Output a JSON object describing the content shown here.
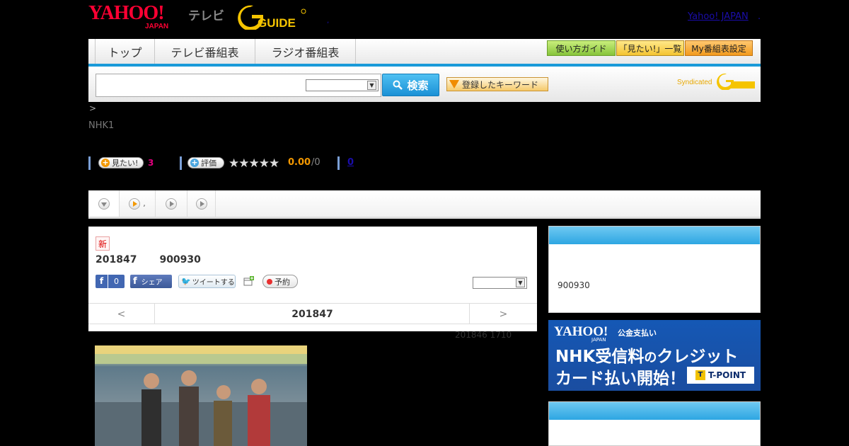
{
  "header": {
    "logo_yahoo": "YAHOO!",
    "logo_japan": "JAPAN",
    "logo_tv": "テレビ",
    "logo_gguide": "GUIDE",
    "yahoo_japan_link": "Yahoo! JAPAN",
    "dot_link": ".",
    "dot_mid": ","
  },
  "nav": {
    "tabs": [
      "トップ",
      "テレビ番組表",
      "ラジオ番組表"
    ],
    "buttons": [
      "使い方ガイド",
      "「見たい!」一覧",
      "My番組表設定"
    ]
  },
  "search": {
    "input_value": "",
    "select_value": "",
    "search_label": "検索",
    "keyword_label": "登録したキーワード",
    "syndicated": "Syndicated"
  },
  "breadcrumb": ">",
  "channel": "NHK1",
  "ratings": {
    "want_label": "見たい!",
    "want_count": "3",
    "review_label": "評価",
    "stars": "★★★★★",
    "score": "0.00",
    "score_den": "/0",
    "comments": "0"
  },
  "tabs": {
    "second_label": ","
  },
  "program": {
    "new_badge": "新",
    "title_date": "201847",
    "title_time": "900930",
    "fb_like_count": "0",
    "fb_share": "シェア",
    "tweet": "ツイートする",
    "reserve": "予約",
    "select_value": "",
    "prev": "<",
    "next": ">",
    "pager_date": "201847",
    "sub_date": "201846  1710"
  },
  "sidebar": {
    "box1_text": "900930",
    "banner": {
      "yahoo": "YAHOO!",
      "japan": "JAPAN",
      "small": "公金支払い",
      "line1_a": "NHK受信料",
      "line1_b": "の",
      "line1_c": "クレジット",
      "line2": "カード払い開始！",
      "tpoint": "T-POINT"
    }
  },
  "colors": {
    "accent_blue": "#1a9ad9",
    "orange": "#f39800",
    "brand_red": "#ff0033"
  }
}
